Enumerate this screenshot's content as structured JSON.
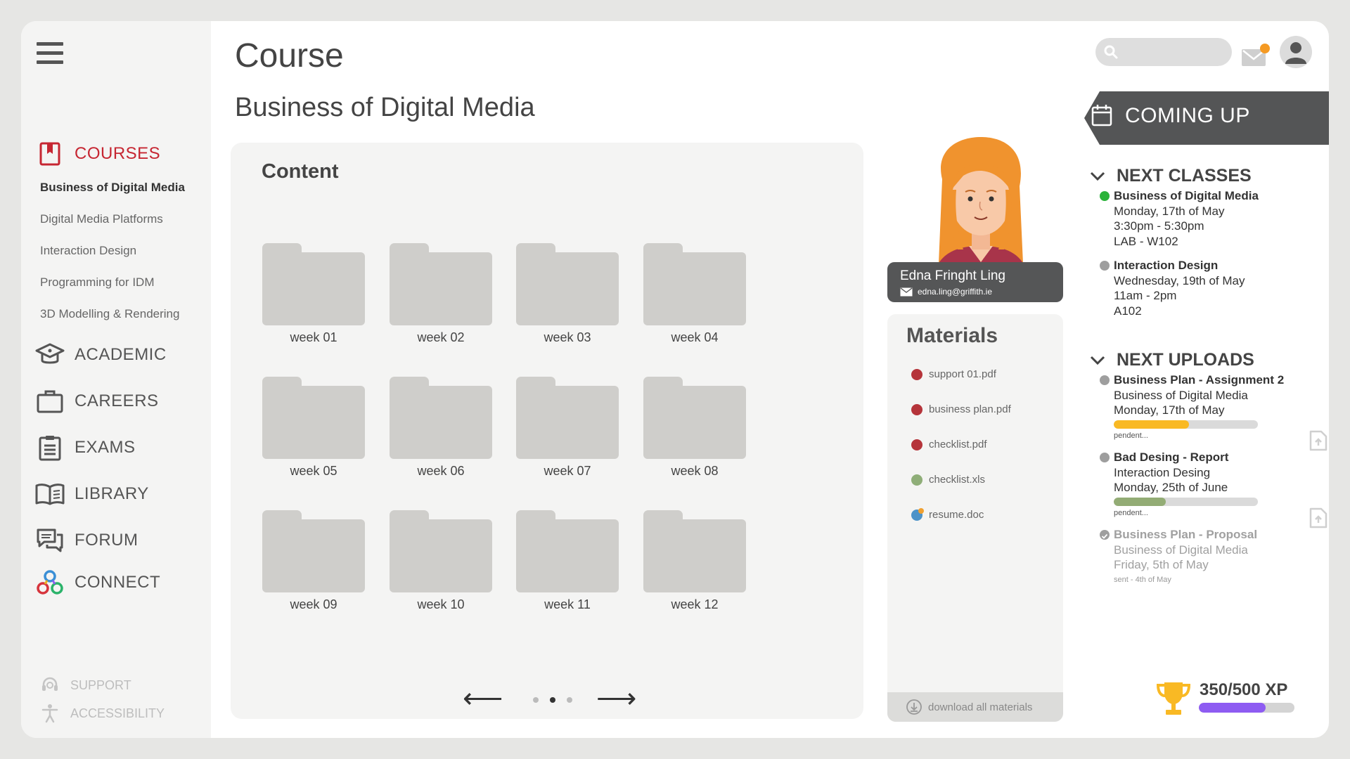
{
  "sidebar": {
    "courses_label": "COURSES",
    "course_items": [
      {
        "label": "Business of Digital Media",
        "active": true
      },
      {
        "label": "Digital Media Platforms"
      },
      {
        "label": "Interaction Design"
      },
      {
        "label": "Programming for IDM"
      },
      {
        "label": "3D Modelling & Rendering"
      }
    ],
    "nav": [
      {
        "label": "ACADEMIC",
        "icon": "graduation-cap-icon"
      },
      {
        "label": "CAREERS",
        "icon": "briefcase-icon"
      },
      {
        "label": "EXAMS",
        "icon": "clipboard-icon"
      },
      {
        "label": "LIBRARY",
        "icon": "book-icon"
      },
      {
        "label": "FORUM",
        "icon": "chat-icon"
      },
      {
        "label": "CONNECT",
        "icon": "connect-icon"
      }
    ],
    "footer": [
      {
        "label": "SUPPORT",
        "icon": "headset-icon"
      },
      {
        "label": "ACCESSIBILITY",
        "icon": "accessibility-icon"
      }
    ],
    "accent_color": "#c62632"
  },
  "header": {
    "title": "Course",
    "subtitle": "Business of Digital Media",
    "search_placeholder": "",
    "notification_color": "#f59a23"
  },
  "content": {
    "title": "Content",
    "folders": [
      "week 01",
      "week 02",
      "week 03",
      "week 04",
      "week 05",
      "week 06",
      "week 07",
      "week 08",
      "week 09",
      "week 10",
      "week 11",
      "week 12"
    ],
    "pager": {
      "prev": "⟵",
      "next": "⟶",
      "pages": 3,
      "current": 2
    }
  },
  "teacher": {
    "name": "Edna Fringht Ling",
    "email": "edna.ling@griffith.ie"
  },
  "materials": {
    "title": "Materials",
    "items": [
      {
        "name": "support 01.pdf",
        "color": "#b5343a"
      },
      {
        "name": "business plan.pdf",
        "color": "#b5343a"
      },
      {
        "name": "checklist.pdf",
        "color": "#b5343a"
      },
      {
        "name": "checklist.xls",
        "color": "#8fae78"
      },
      {
        "name": "resume.doc",
        "color": "#4d93c8",
        "accent": "#f0a030"
      }
    ],
    "download_label": "download all materials"
  },
  "coming_up": {
    "label": "COMING UP",
    "next_classes": {
      "label": "NEXT CLASSES",
      "items": [
        {
          "title": "Business of Digital Media",
          "date": "Monday, 17th of May",
          "time": "3:30pm - 5:30pm",
          "room": "LAB - W102",
          "status_color": "#2bb33a"
        },
        {
          "title": "Interaction Design",
          "date": "Wednesday, 19th of May",
          "time": "11am - 2pm",
          "room": "A102",
          "status_color": "#9e9e9e"
        }
      ]
    },
    "next_uploads": {
      "label": "NEXT UPLOADS",
      "items": [
        {
          "title": "Business Plan - Assignment 2",
          "course": "Business of Digital Media",
          "date": "Monday, 17th of May",
          "progress": 0.52,
          "progress_color": "#f9b924",
          "status": "pendent..."
        },
        {
          "title": "Bad Desing - Report",
          "course": "Interaction Desing",
          "date": "Monday, 25th of June",
          "progress": 0.36,
          "progress_color": "#93ac75",
          "status": "pendent..."
        },
        {
          "title": "Business Plan - Proposal",
          "course": "Business of Digital Media",
          "date": "Friday, 5th of May",
          "status": "sent - 4th of May",
          "done": true
        }
      ]
    }
  },
  "xp": {
    "label": "350/500 XP",
    "current": 350,
    "total": 500,
    "color": "#8e5cf2"
  }
}
